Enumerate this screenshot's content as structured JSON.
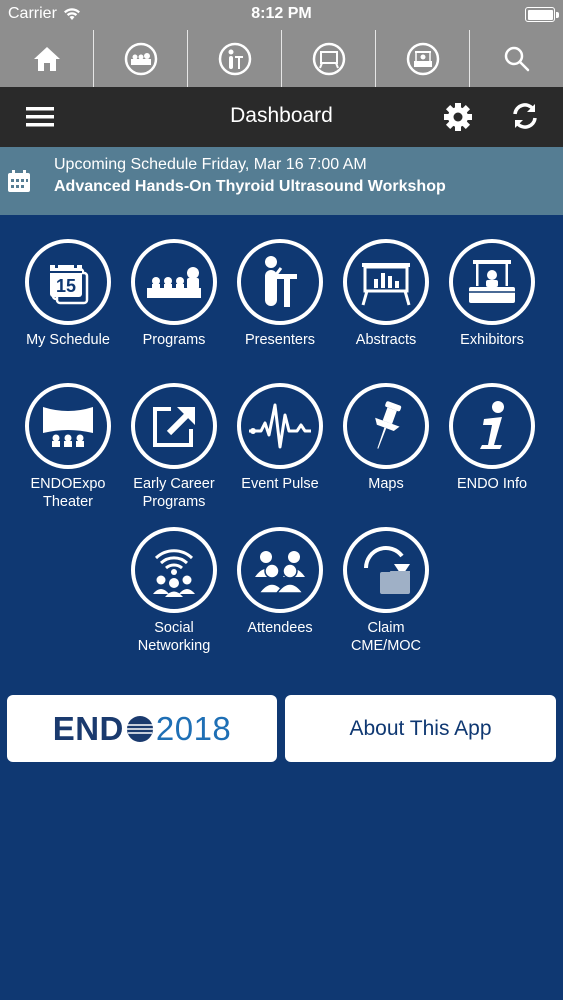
{
  "status": {
    "carrier": "Carrier",
    "time": "8:12 PM"
  },
  "topnav": {
    "items": [
      {
        "icon": "home-icon"
      },
      {
        "icon": "programs-icon"
      },
      {
        "icon": "presenters-icon"
      },
      {
        "icon": "abstracts-icon"
      },
      {
        "icon": "exhibitors-icon"
      },
      {
        "icon": "search-icon"
      }
    ]
  },
  "header": {
    "title": "Dashboard"
  },
  "upcoming": {
    "line1": "Upcoming Schedule Friday, Mar 16 7:00 AM",
    "line2": "Advanced Hands-On Thyroid Ultrasound Workshop"
  },
  "tiles": [
    {
      "label": "My Schedule",
      "icon": "calendar-15-icon"
    },
    {
      "label": "Programs",
      "icon": "programs-icon"
    },
    {
      "label": "Presenters",
      "icon": "presenters-icon"
    },
    {
      "label": "Abstracts",
      "icon": "abstracts-icon"
    },
    {
      "label": "Exhibitors",
      "icon": "exhibitors-icon"
    },
    {
      "label": "ENDOExpo Theater",
      "icon": "theater-icon"
    },
    {
      "label": "Early Career Programs",
      "icon": "external-link-icon"
    },
    {
      "label": "Event Pulse",
      "icon": "pulse-icon"
    },
    {
      "label": "Maps",
      "icon": "pushpin-icon"
    },
    {
      "label": "ENDO Info",
      "icon": "info-icon"
    },
    {
      "label": "Social Networking",
      "icon": "social-wifi-icon"
    },
    {
      "label": "Attendees",
      "icon": "attendees-icon"
    },
    {
      "label": "Claim CME/MOC",
      "icon": "claim-download-icon"
    }
  ],
  "calendar_day": "15",
  "buttons": {
    "endo_left": "END",
    "endo_year": "2018",
    "about": "About This App"
  },
  "colors": {
    "background": "#0f3872",
    "statusbar": "#8e8e8e",
    "titlebar": "#2a2a2a",
    "upcoming": "#557d93"
  }
}
